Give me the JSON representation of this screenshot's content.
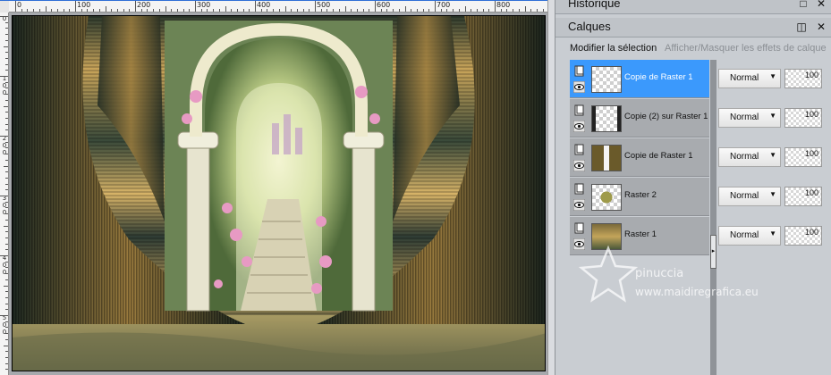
{
  "rulers": {
    "top_labels": [
      "0",
      "100",
      "200",
      "300",
      "400",
      "500",
      "600",
      "700",
      "800"
    ],
    "left_labels": [
      [
        "0"
      ],
      [
        "1",
        "0",
        "0"
      ],
      [
        "2",
        "0",
        "0"
      ],
      [
        "3",
        "0",
        "0"
      ],
      [
        "4",
        "0",
        "0"
      ],
      [
        "5",
        "0",
        "0"
      ]
    ]
  },
  "panels": {
    "history": {
      "title": "Historique"
    },
    "layers": {
      "title": "Calques",
      "toolbar": {
        "edit_selection": "Modifier la sélection",
        "toggle_effects": "Afficher/Masquer les effets de calque"
      },
      "items": [
        {
          "name": "Copie de Raster 1",
          "blend": "Normal",
          "opacity": "100",
          "selected": true
        },
        {
          "name": "Copie (2) sur Raster 1",
          "blend": "Normal",
          "opacity": "100",
          "selected": false
        },
        {
          "name": "Copie de Raster 1",
          "blend": "Normal",
          "opacity": "100",
          "selected": false
        },
        {
          "name": "Raster 2",
          "blend": "Normal",
          "opacity": "100",
          "selected": false
        },
        {
          "name": "Raster 1",
          "blend": "Normal",
          "opacity": "100",
          "selected": false
        }
      ]
    }
  },
  "watermark": {
    "line1": "pinuccia",
    "line2": "www.maidiregrafica.eu"
  },
  "colors": {
    "selection": "#3b99fc",
    "panel": "#c9cdd2",
    "layer_row": "#a8abaf"
  },
  "icons": [
    "eye-icon",
    "layer-icon",
    "dropdown-caret-icon",
    "panel-menu-icon",
    "panel-close-icon",
    "splitter-arrow-icon"
  ]
}
